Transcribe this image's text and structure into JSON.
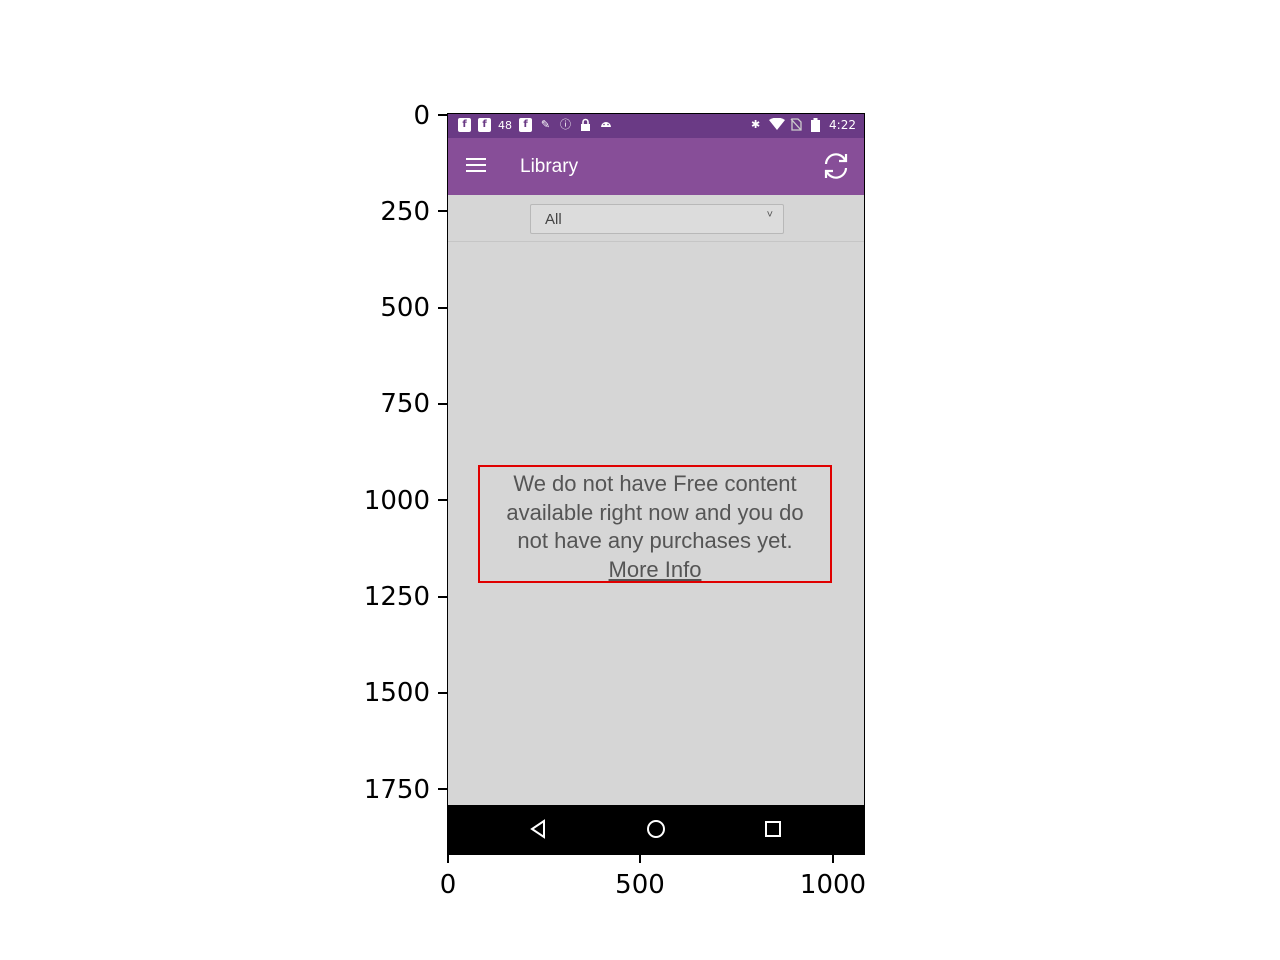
{
  "statusbar": {
    "left_icons": [
      "facebook-icon",
      "facebook-icon",
      "48",
      "facebook-icon",
      "tools-icon",
      "info-icon",
      "lock-icon",
      "android-icon"
    ],
    "temp_text": "48",
    "time": "4:22",
    "right_icons": [
      "bluetooth-icon",
      "wifi-icon",
      "no-sim-icon",
      "battery-icon"
    ]
  },
  "appbar": {
    "title": "Library",
    "menu_icon": "hamburger-menu-icon",
    "refresh_icon": "refresh-icon",
    "background": "#874e98"
  },
  "filter": {
    "selected": "All"
  },
  "empty_state": {
    "message_line1": "We do not have Free content",
    "message_line2": "available right now and you do",
    "message_line3": "not have any purchases yet.",
    "link": "More Info"
  },
  "navbar": {
    "icons": [
      "back-icon",
      "home-icon",
      "recents-icon"
    ]
  },
  "axes": {
    "y_ticks": [
      "0",
      "250",
      "500",
      "750",
      "1000",
      "1250",
      "1500",
      "1750"
    ],
    "x_ticks": [
      "0",
      "500",
      "1000"
    ]
  }
}
